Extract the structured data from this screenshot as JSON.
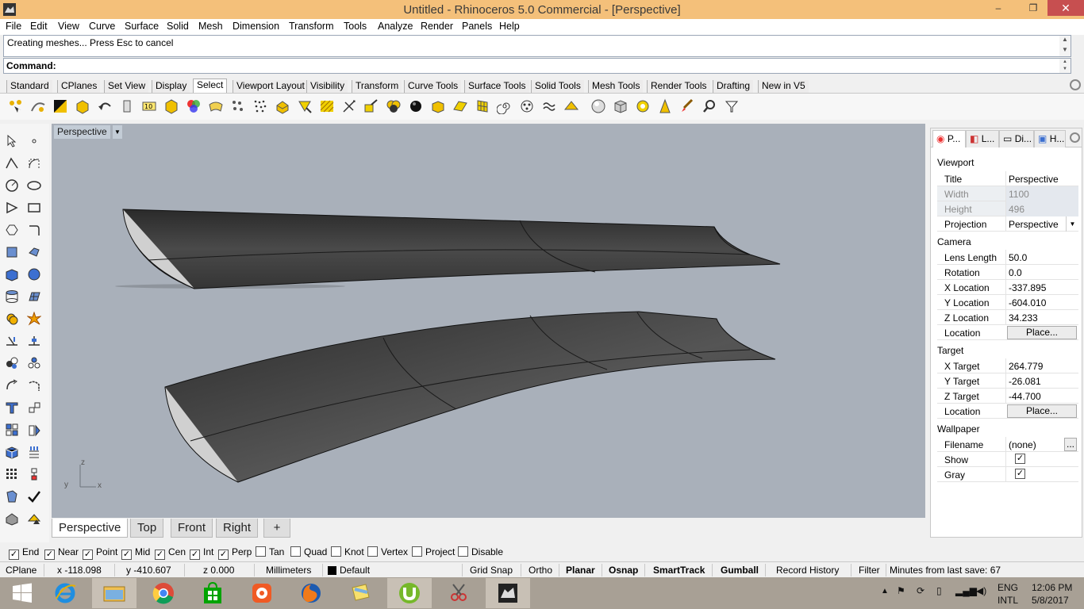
{
  "window": {
    "title": "Untitled - Rhinoceros 5.0 Commercial - [Perspective]",
    "minimize": "–",
    "restore": "❐",
    "close": "✕"
  },
  "menu": [
    "File",
    "Edit",
    "View",
    "Curve",
    "Surface",
    "Solid",
    "Mesh",
    "Dimension",
    "Transform",
    "Tools",
    "Analyze",
    "Render",
    "Panels",
    "Help"
  ],
  "command": {
    "history_line": "Creating meshes... Press Esc to cancel",
    "prompt_label": "Command:",
    "value": ""
  },
  "toolbar_tabs": [
    "Standard",
    "CPlanes",
    "Set View",
    "Display",
    "Select",
    "Viewport Layout",
    "Visibility",
    "Transform",
    "Curve Tools",
    "Surface Tools",
    "Solid Tools",
    "Mesh Tools",
    "Render Tools",
    "Drafting",
    "New in V5"
  ],
  "active_toolbar_tab": "Select",
  "viewport": {
    "title": "Perspective",
    "axis_z": "z",
    "axis_y": "y",
    "axis_x": "x",
    "background": "#a9b0ba"
  },
  "viewport_tabs": [
    "Perspective",
    "Top",
    "Front",
    "Right"
  ],
  "viewport_add": "+",
  "properties": {
    "tabs": [
      "P...",
      "L...",
      "Di...",
      "H..."
    ],
    "viewport_header": "Viewport",
    "title_label": "Title",
    "title_value": "Perspective",
    "width_label": "Width",
    "width_value": "1100",
    "height_label": "Height",
    "height_value": "496",
    "projection_label": "Projection",
    "projection_value": "Perspective",
    "camera_header": "Camera",
    "lens_label": "Lens Length",
    "lens_value": "50.0",
    "rotation_label": "Rotation",
    "rotation_value": "0.0",
    "xloc_label": "X Location",
    "xloc_value": "-337.895",
    "yloc_label": "Y Location",
    "yloc_value": "-604.010",
    "zloc_label": "Z Location",
    "zloc_value": "34.233",
    "loc_label": "Location",
    "place_label": "Place...",
    "target_header": "Target",
    "xt_label": "X Target",
    "xt_value": "264.779",
    "yt_label": "Y Target",
    "yt_value": "-26.081",
    "zt_label": "Z Target",
    "zt_value": "-44.700",
    "tloc_label": "Location",
    "tplace_label": "Place...",
    "wallpaper_header": "Wallpaper",
    "file_label": "Filename",
    "file_value": "(none)",
    "browse_label": "...",
    "show_label": "Show",
    "gray_label": "Gray"
  },
  "osnaps": [
    {
      "label": "End",
      "checked": true
    },
    {
      "label": "Near",
      "checked": true
    },
    {
      "label": "Point",
      "checked": true
    },
    {
      "label": "Mid",
      "checked": true
    },
    {
      "label": "Cen",
      "checked": true
    },
    {
      "label": "Int",
      "checked": true
    },
    {
      "label": "Perp",
      "checked": true
    },
    {
      "label": "Tan",
      "checked": false
    },
    {
      "label": "Quad",
      "checked": false
    },
    {
      "label": "Knot",
      "checked": false
    },
    {
      "label": "Vertex",
      "checked": false
    },
    {
      "label": "Project",
      "checked": false
    },
    {
      "label": "Disable",
      "checked": false
    }
  ],
  "status": {
    "cplane": "CPlane",
    "x": "x -118.098",
    "y": "y -410.607",
    "z": "z 0.000",
    "units": "Millimeters",
    "layer": "Default",
    "grid_snap": "Grid Snap",
    "ortho": "Ortho",
    "planar": "Planar",
    "osnap": "Osnap",
    "smarttrack": "SmartTrack",
    "gumball": "Gumball",
    "record_history": "Record History",
    "filter": "Filter",
    "minutes": "Minutes from last save: 67"
  },
  "taskbar": {
    "lang_top": "ENG",
    "lang_bottom": "INTL",
    "time": "12:06 PM",
    "date": "5/8/2017"
  },
  "colors": {
    "titlebar": "#f4c07a",
    "close": "#c74f50",
    "taskbar": "#a8a095",
    "surface": "#3a3a3a"
  }
}
